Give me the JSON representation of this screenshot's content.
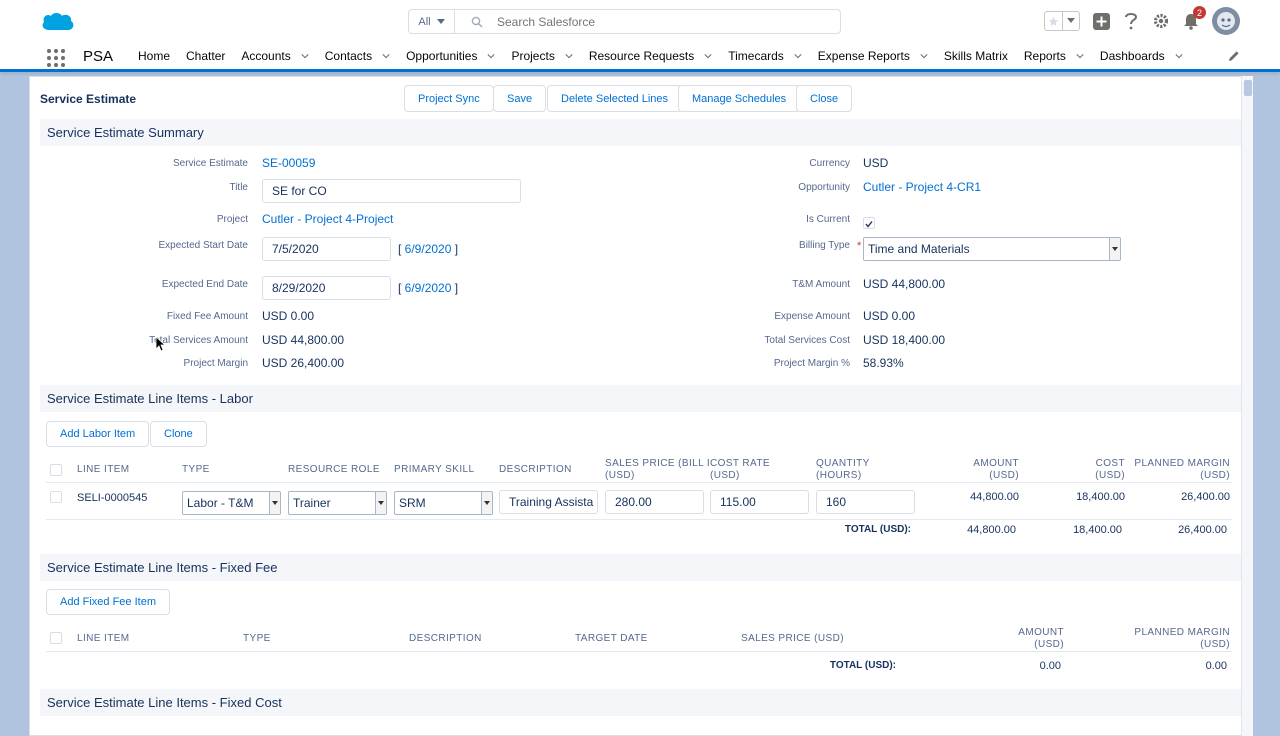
{
  "header": {
    "search_scope": "All",
    "search_placeholder": "Search Salesforce",
    "notification_count": "2",
    "colors": {
      "brand": "#00a1e0",
      "link": "#0070d2",
      "badge": "#c23934"
    }
  },
  "nav": {
    "app_name": "PSA",
    "items": [
      {
        "label": "Home",
        "dropdown": false
      },
      {
        "label": "Chatter",
        "dropdown": false
      },
      {
        "label": "Accounts",
        "dropdown": true
      },
      {
        "label": "Contacts",
        "dropdown": true
      },
      {
        "label": "Opportunities",
        "dropdown": true
      },
      {
        "label": "Projects",
        "dropdown": true
      },
      {
        "label": "Resource Requests",
        "dropdown": true
      },
      {
        "label": "Timecards",
        "dropdown": true
      },
      {
        "label": "Expense Reports",
        "dropdown": true
      },
      {
        "label": "Skills Matrix",
        "dropdown": false
      },
      {
        "label": "Reports",
        "dropdown": true
      },
      {
        "label": "Dashboards",
        "dropdown": true
      }
    ]
  },
  "page": {
    "title": "Service Estimate",
    "buttons": {
      "project_sync": "Project Sync",
      "save": "Save",
      "delete_lines": "Delete Selected Lines",
      "manage_schedules": "Manage Schedules",
      "close": "Close"
    }
  },
  "summary": {
    "header": "Service Estimate Summary",
    "left": {
      "service_estimate_label": "Service Estimate",
      "service_estimate_value": "SE-00059",
      "title_label": "Title",
      "title_value": "SE for CO",
      "project_label": "Project",
      "project_value": "Cutler - Project 4-Project",
      "start_label": "Expected Start Date",
      "start_value": "7/5/2020",
      "start_today": "6/9/2020",
      "end_label": "Expected End Date",
      "end_value": "8/29/2020",
      "end_today": "6/9/2020",
      "fixed_fee_label": "Fixed Fee Amount",
      "fixed_fee_value": "USD 0.00",
      "total_services_label": "Total Services Amount",
      "total_services_value": "USD 44,800.00",
      "margin_label": "Project Margin",
      "margin_value": "USD 26,400.00"
    },
    "right": {
      "currency_label": "Currency",
      "currency_value": "USD",
      "opportunity_label": "Opportunity",
      "opportunity_value": "Cutler - Project 4-CR1",
      "is_current_label": "Is Current",
      "is_current_checked": true,
      "billing_type_label": "Billing Type",
      "billing_type_value": "Time and Materials",
      "tm_amount_label": "T&M Amount",
      "tm_amount_value": "USD 44,800.00",
      "expense_label": "Expense Amount",
      "expense_value": "USD 0.00",
      "total_cost_label": "Total Services Cost",
      "total_cost_value": "USD 18,400.00",
      "margin_pct_label": "Project Margin %",
      "margin_pct_value": "58.93%"
    }
  },
  "labor": {
    "header": "Service Estimate Line Items - Labor",
    "add_button": "Add Labor Item",
    "clone_button": "Clone",
    "columns": {
      "line_item": "LINE ITEM",
      "type": "TYPE",
      "resource_role": "RESOURCE ROLE",
      "primary_skill": "PRIMARY SKILL",
      "description": "DESCRIPTION",
      "sales_price_1": "SALES PRICE (BILL I",
      "sales_price_2": "(USD)",
      "cost_rate_1": "COST RATE",
      "cost_rate_2": "(USD)",
      "quantity_1": "QUANTITY",
      "quantity_2": "(HOURS)",
      "amount_1": "AMOUNT",
      "amount_2": "(USD)",
      "cost_1": "COST",
      "cost_2": "(USD)",
      "planned_margin_1": "PLANNED MARGIN",
      "planned_margin_2": "(USD)"
    },
    "row": {
      "line_item": "SELI-0000545",
      "type": "Labor - T&M",
      "resource_role": "Trainer",
      "primary_skill": "SRM",
      "description": "Training Assista",
      "sales_price": "280.00",
      "cost_rate": "115.00",
      "quantity": "160",
      "amount": "44,800.00",
      "cost": "18,400.00",
      "planned_margin": "26,400.00"
    },
    "totals": {
      "label": "TOTAL (USD):",
      "amount": "44,800.00",
      "cost": "18,400.00",
      "planned_margin": "26,400.00"
    }
  },
  "fixed_fee": {
    "header": "Service Estimate Line Items - Fixed Fee",
    "add_button": "Add Fixed Fee Item",
    "columns": {
      "line_item": "LINE ITEM",
      "type": "TYPE",
      "description": "DESCRIPTION",
      "target_date": "TARGET DATE",
      "sales_price": "SALES PRICE (USD)",
      "amount_1": "AMOUNT",
      "amount_2": "(USD)",
      "planned_margin_1": "PLANNED MARGIN",
      "planned_margin_2": "(USD)"
    },
    "totals": {
      "label": "TOTAL (USD):",
      "amount": "0.00",
      "planned_margin": "0.00"
    }
  },
  "fixed_cost": {
    "header": "Service Estimate Line Items - Fixed Cost"
  }
}
